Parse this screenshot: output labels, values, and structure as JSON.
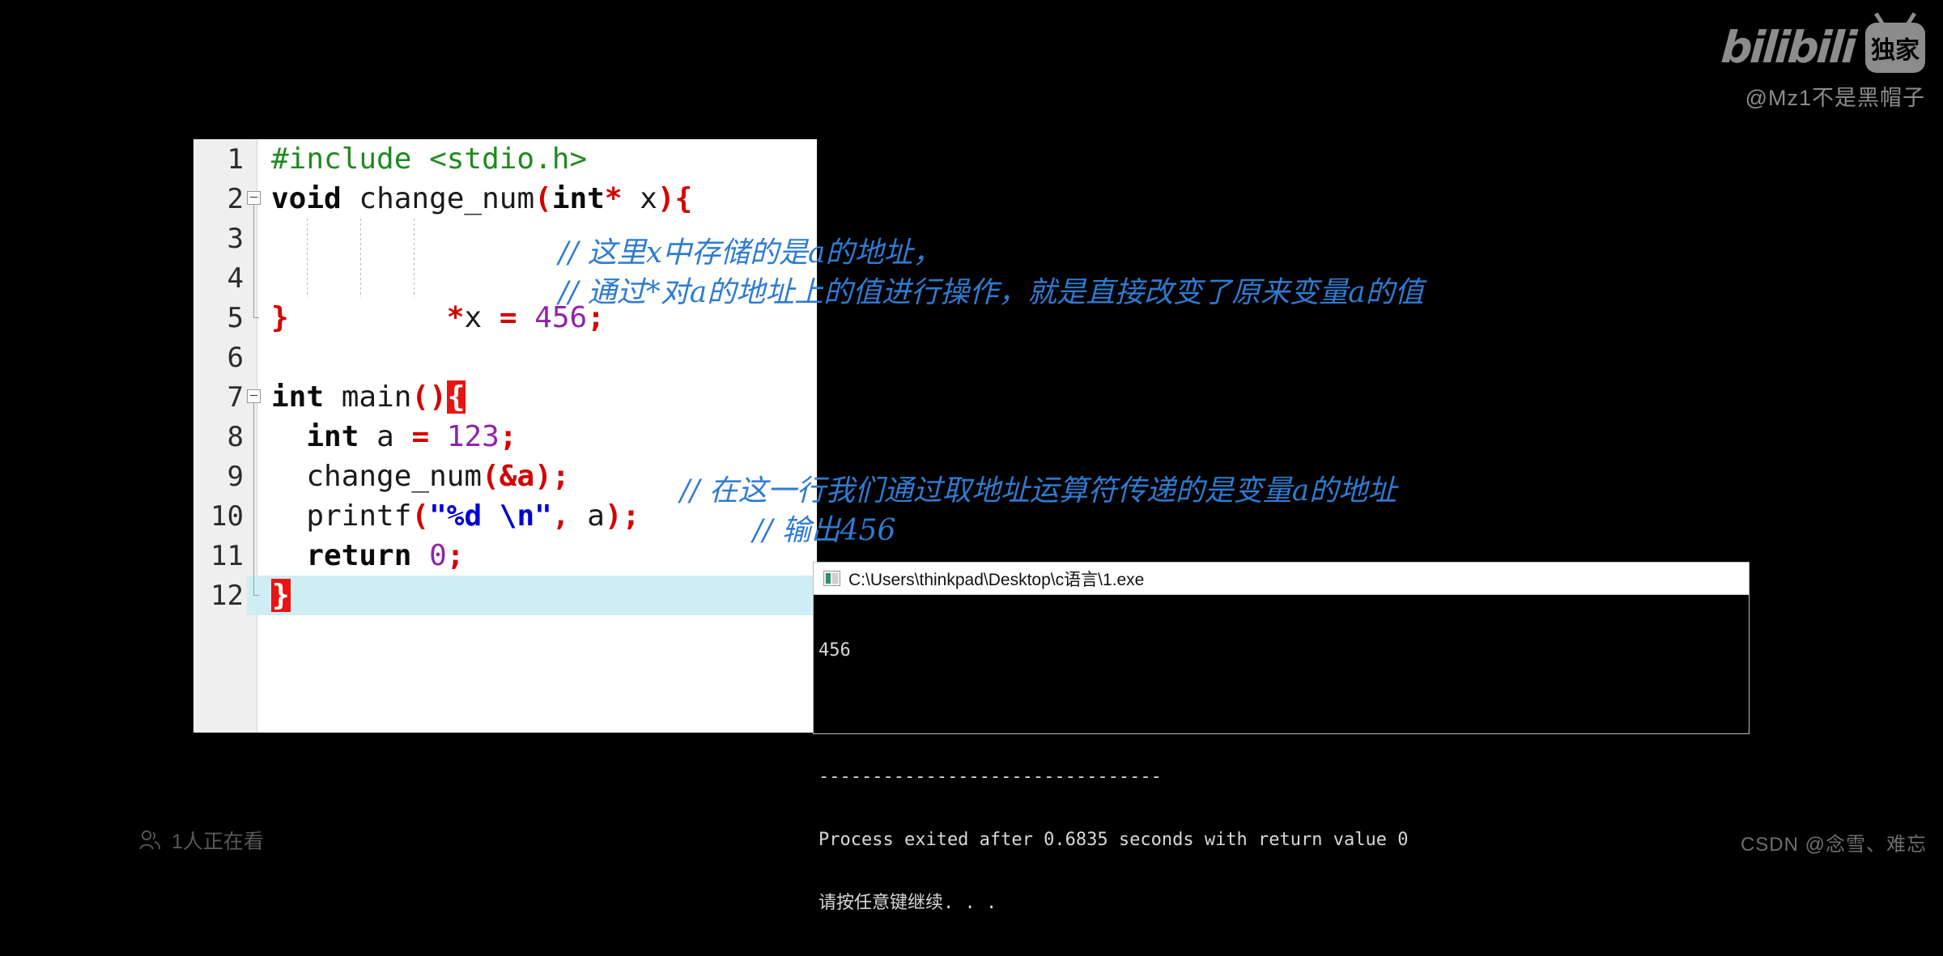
{
  "watermark": {
    "bilibili_logo_text": "bilibili",
    "bilibili_badge_text": "独家",
    "handle": "@Mz1不是黑帽子"
  },
  "editor": {
    "lines": [
      {
        "number": "1",
        "code": "#include <stdio.h>"
      },
      {
        "number": "2",
        "code": "void change_num(int* x){"
      },
      {
        "number": "3",
        "code": "  *x = 456;",
        "comment": "// 这里x中存储的是a的地址，"
      },
      {
        "number": "4",
        "code": "",
        "comment": "// 通过*对a的地址上的值进行操作，就是直接改变了原来变量a的值"
      },
      {
        "number": "5",
        "code": "}"
      },
      {
        "number": "6",
        "code": ""
      },
      {
        "number": "7",
        "code": "int main(){"
      },
      {
        "number": "8",
        "code": "    int a = 123;"
      },
      {
        "number": "9",
        "code": "    change_num(&a);",
        "comment": "// 在这一行我们通过取地址运算符传递的是变量a的地址"
      },
      {
        "number": "10",
        "code": "    printf(\"%d \\n\", a);",
        "comment": "// 输出456"
      },
      {
        "number": "11",
        "code": "    return 0;"
      },
      {
        "number": "12",
        "code": "}"
      }
    ],
    "tokens": {
      "preprocessor": "#include <stdio.h>",
      "kw_void": "void",
      "fn_change_num": "change_num",
      "kw_int": "int",
      "star": "*",
      "param_x": " x",
      "deref_x": "*x",
      "assign": "=",
      "num_456": "456",
      "num_123": "123",
      "num_0": "0",
      "kw_return": "return",
      "fn_printf": "printf",
      "str_fmt": "\"%d \\n\"",
      "var_a": "a",
      "amp_a": "&a",
      "brace_open": "{",
      "brace_close": "}",
      "paren_open": "(",
      "paren_close": ")",
      "semicolon": ";",
      "comma": ","
    },
    "colors": {
      "preprocessor": "#1f8a1f",
      "keyword": "#0b0b0b",
      "punctuation": "#d40000",
      "number": "#8f24a8",
      "string": "#0000d6",
      "comment": "#2f7bd0",
      "brace_highlight_bg": "#e81414",
      "active_line_bg": "#cfeef3",
      "gutter_bg": "#efefef",
      "editor_bg": "#ffffff"
    },
    "active_line_number": "12"
  },
  "console": {
    "title": "C:\\Users\\thinkpad\\Desktop\\c语言\\1.exe",
    "icon": "console-app-icon",
    "output_lines": [
      "456",
      "--------------------------------",
      "Process exited after 0.6835 seconds with return value 0",
      "请按任意键继续. . ."
    ]
  },
  "status": {
    "viewers_text": "1人正在看",
    "viewers_icon": "people-icon"
  },
  "footer": {
    "csdn_watermark": "CSDN @念雪、难忘"
  }
}
